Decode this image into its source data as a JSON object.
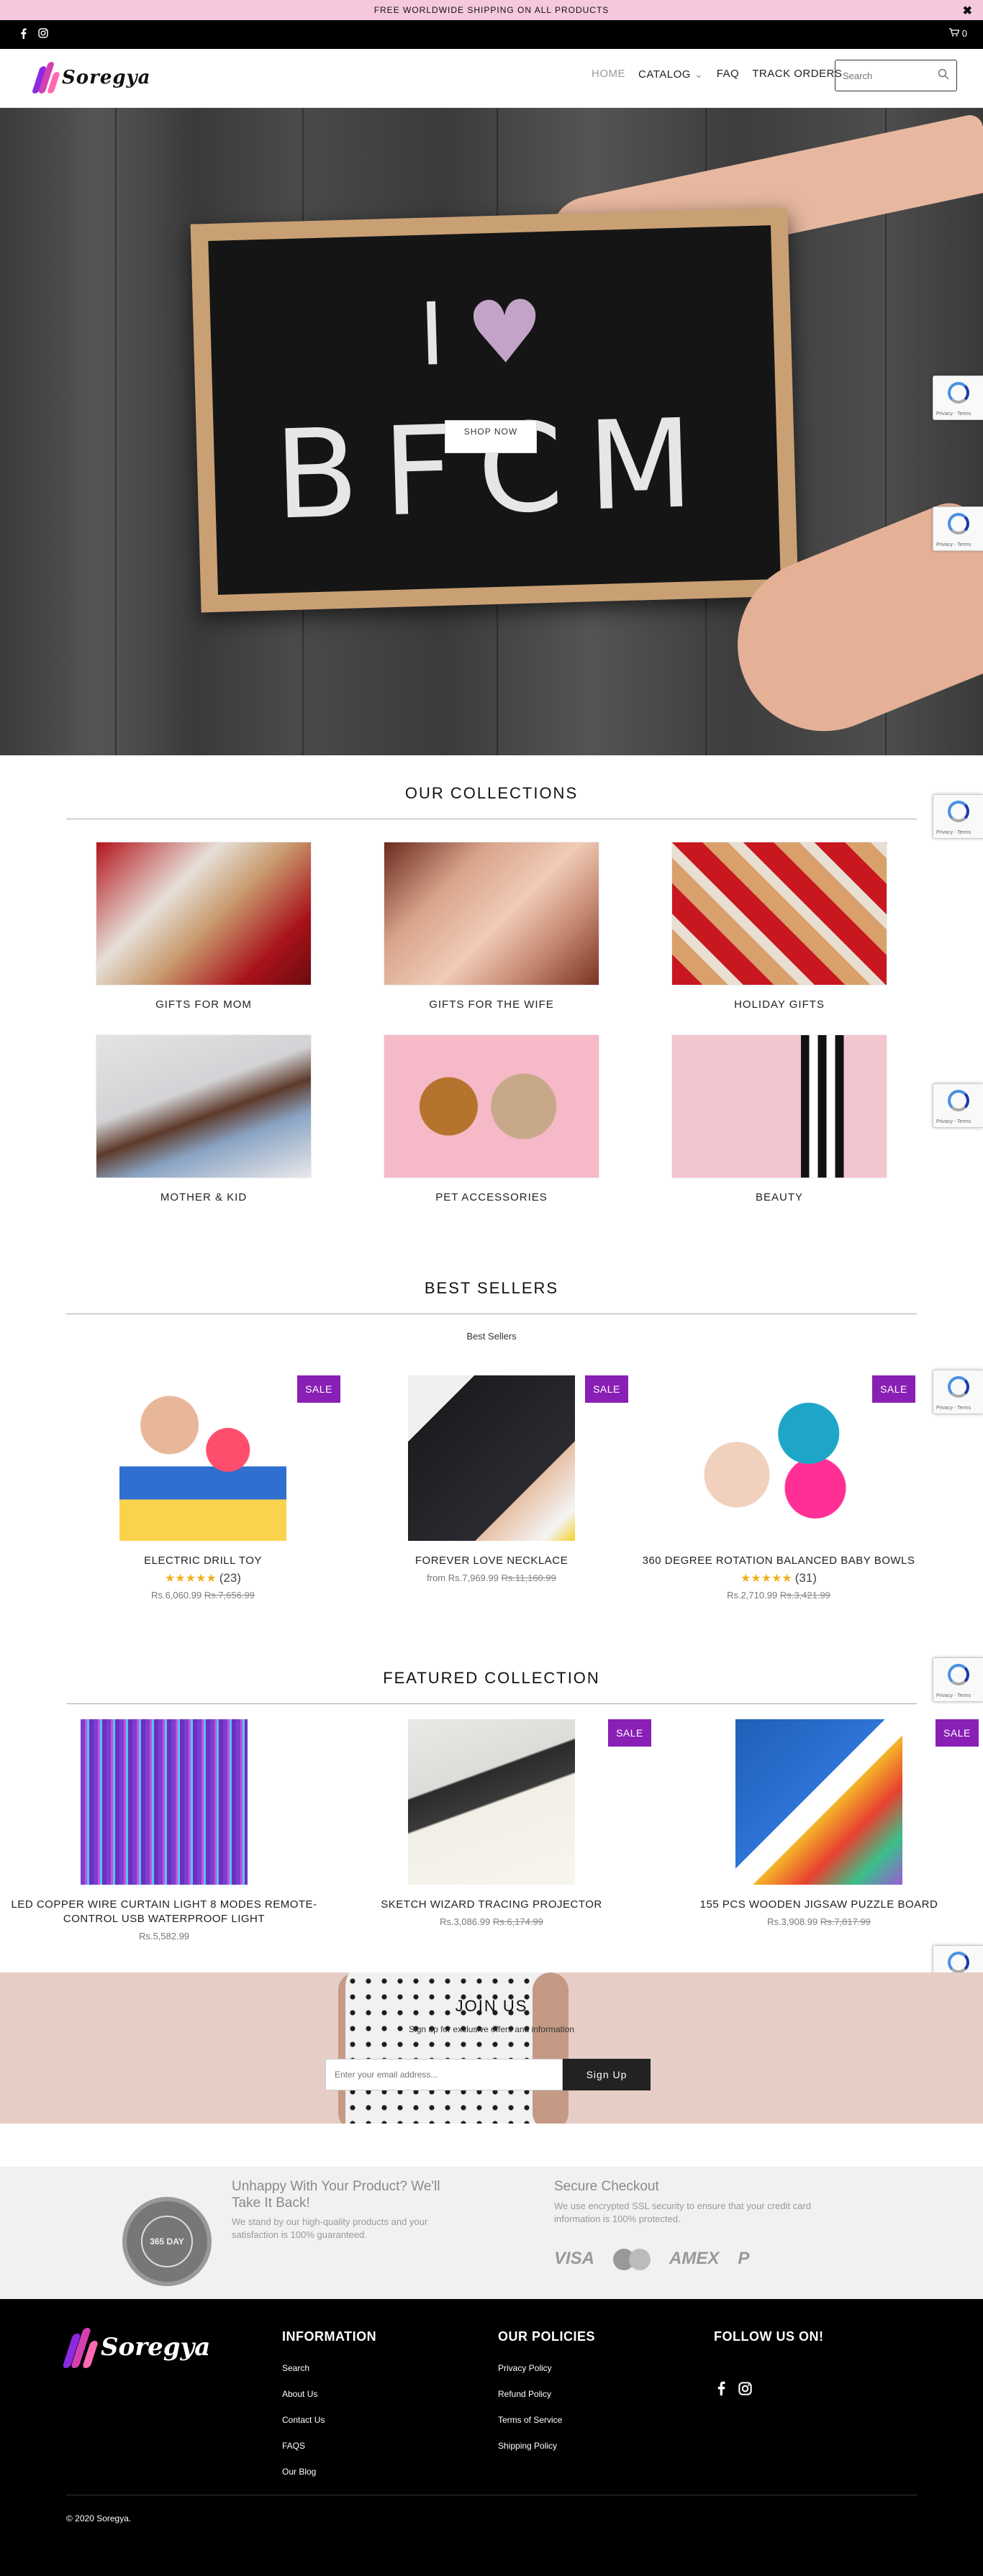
{
  "announcement": {
    "text": "FREE WORLDWIDE SHIPPING ON ALL PRODUCTS",
    "close": "✖"
  },
  "topbar": {
    "cart_count": "0"
  },
  "brand": {
    "name": "Soregya",
    "colors": {
      "purple": "#8a2be2",
      "magenta": "#d63fb0",
      "pink": "#ff69b4"
    }
  },
  "nav": {
    "home": "HOME",
    "catalog": "CATALOG",
    "faq": "FAQ",
    "track": "TRACK ORDERS"
  },
  "search": {
    "placeholder": "Search"
  },
  "hero": {
    "board_line1_left": "I",
    "board_line2": "BFCM",
    "cta": "SHOP NOW"
  },
  "collections": {
    "title": "OUR COLLECTIONS",
    "items": [
      {
        "label": "GIFTS FOR MOM"
      },
      {
        "label": "GIFTS FOR THE WIFE"
      },
      {
        "label": "HOLIDAY GIFTS"
      },
      {
        "label": "MOTHER & KID"
      },
      {
        "label": "PET ACCESSORIES"
      },
      {
        "label": "BEAUTY"
      }
    ]
  },
  "best_sellers": {
    "title": "BEST SELLERS",
    "subtitle": "Best Sellers",
    "products": [
      {
        "name": "ELECTRIC DRILL TOY",
        "badge": "SALE",
        "rating": 5,
        "stars": "★★★★★",
        "reviews": "(23)",
        "price": "Rs.6,060.99",
        "compare": "Rs.7,656.99"
      },
      {
        "name": "FOREVER LOVE NECKLACE",
        "badge": "SALE",
        "price_prefix": "from",
        "price": "Rs.7,969.99",
        "compare": "Rs.11,160.99"
      },
      {
        "name": "360 DEGREE ROTATION BALANCED BABY BOWLS",
        "badge": "SALE",
        "rating": 5,
        "stars": "★★★★★",
        "reviews": "(31)",
        "price": "Rs.2,710.99",
        "compare": "Rs.3,421.99"
      }
    ]
  },
  "featured": {
    "title": "FEATURED COLLECTION",
    "products": [
      {
        "name": "LED COPPER WIRE CURTAIN LIGHT 8 MODES REMOTE-CONTROL USB WATERPROOF LIGHT",
        "price": "Rs.5,582.99"
      },
      {
        "name": "SKETCH WIZARD TRACING PROJECTOR",
        "badge": "SALE",
        "price": "Rs.3,086.99",
        "compare": "Rs.6,174.99"
      },
      {
        "name": "155 PCS WOODEN JIGSAW PUZZLE BOARD",
        "badge": "SALE",
        "price": "Rs.3,908.99",
        "compare": "Rs.7,817.99"
      }
    ]
  },
  "newsletter": {
    "title": "JOIN US",
    "subtitle": "Sign up for exclusive offers and information",
    "placeholder": "Enter your email address...",
    "button": "Sign Up"
  },
  "trust": {
    "seal": "365 DAY",
    "left_title": "Unhappy With Your Product? We'll Take It Back!",
    "left_text": "We stand by our high-quality products and your satisfaction is 100% guaranteed.",
    "right_title": "Secure Checkout",
    "right_text": "We use encrypted SSL security to ensure that your credit card information is 100% protected.",
    "cards": [
      "VISA",
      "AMEX",
      "P"
    ]
  },
  "footer": {
    "information": {
      "title": "INFORMATION",
      "links": [
        "Search",
        "About Us",
        "Contact Us",
        "FAQS",
        "Our Blog"
      ]
    },
    "policies": {
      "title": "OUR POLICIES",
      "links": [
        "Privacy Policy",
        "Refund Policy",
        "Terms of Service",
        "Shipping Policy"
      ]
    },
    "follow": {
      "title": "FOLLOW US ON!"
    },
    "copyright": "© 2020 Soregya."
  },
  "recaptcha": {
    "text": "Privacy - Terms"
  }
}
